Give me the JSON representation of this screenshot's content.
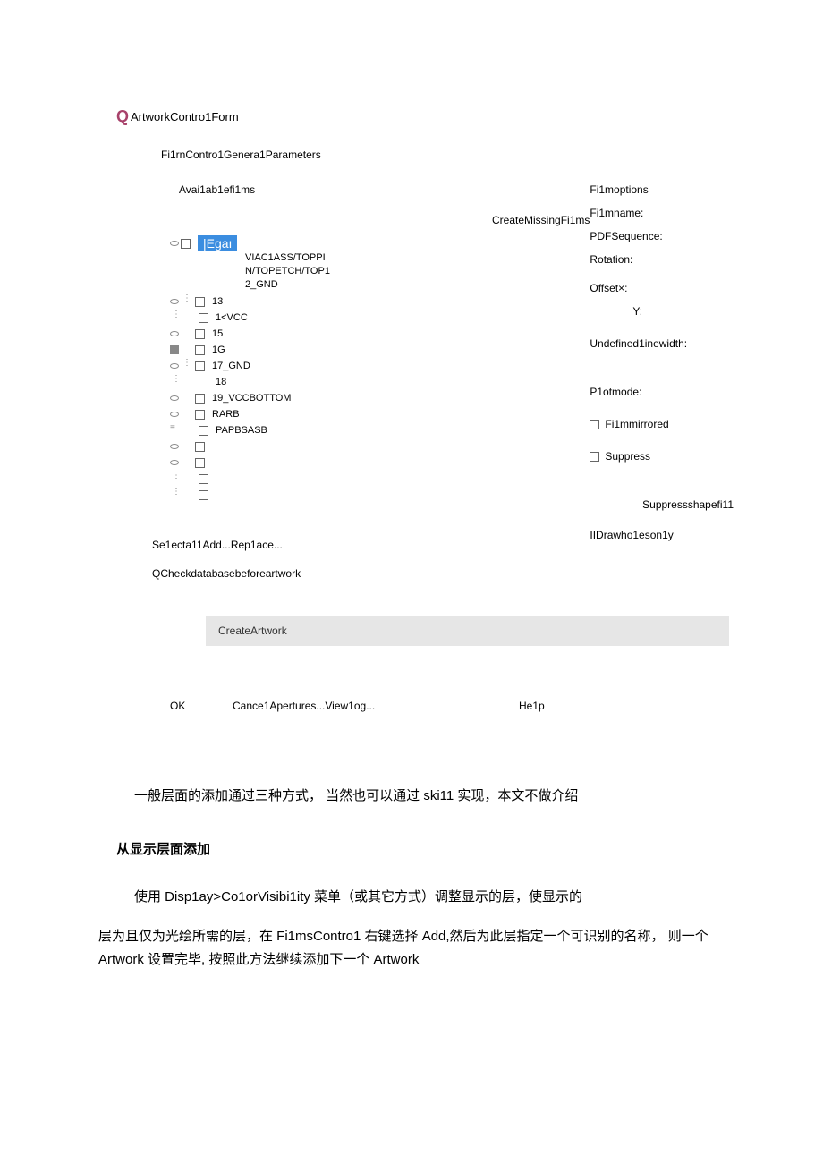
{
  "dialog": {
    "q_prefix": "Q",
    "title": "ArtworkContro1Form",
    "tabs_label": "Fi1rnContro1Genera1Parameters",
    "available_label": "Avai1ab1efi1ms",
    "create_missing": "CreateMissingFi1ms",
    "tree": {
      "highlight_label": "|Egaı",
      "line1": "VIAC1ASS/TOPPI",
      "line2": "N/TOPETCH/TOP1",
      "line3": "2_GND",
      "items": [
        "13",
        "1<VCC",
        "15",
        "1G",
        "17_GND",
        "18",
        "19_VCCBOTTOM",
        "RARB",
        "PAPBSASB"
      ]
    },
    "select_row": "Se1ecta11Add...Rep1ace...",
    "qcheck": "QCheckdatabasebeforeartwork",
    "create_artwork_btn": "CreateArtwork",
    "buttons": {
      "ok": "OK",
      "cancel_etc": "Cance1Apertures...View1og...",
      "help": "He1p"
    }
  },
  "options": {
    "header": "Fi1moptions",
    "filmname": "Fi1mname:",
    "pdfseq": "PDFSequence:",
    "rotation": "Rotation:",
    "offsetx": "Offset×:",
    "offsety": "Y:",
    "undef": "Undefined1inewidth:",
    "plotmode": "P1otmode:",
    "mirrored": "Fi1mmirrored",
    "suppress": "Suppress",
    "suppress_shape": "Suppressshapefi11",
    "drawhole_prefix": "II",
    "drawhole": "Drawho1eson1y"
  },
  "doc": {
    "para1": "一般层面的添加通过三种方式， 当然也可以通过 ski11 实现，本文不做介绍",
    "heading": "从显示层面添加",
    "para2": "使用 Disp1ay>Co1orVisibi1ity 菜单（或其它方式）调整显示的层，使显示的",
    "para3": "层为且仅为光绘所需的层，在 Fi1msContro1 右键选择 Add,然后为此层指定一个可识别的名称， 则一个 Artwork 设置完毕, 按照此方法继续添加下一个 Artwork"
  }
}
